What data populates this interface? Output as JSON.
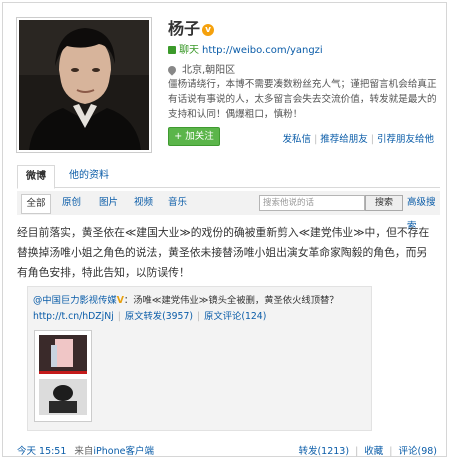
{
  "profile": {
    "name": "杨子",
    "verified_mark": "v",
    "url_label": "聊天",
    "url": "http://weibo.com/yangzi",
    "location": "北京,朝阳区",
    "bio": "僵杨请绕行，本博不需要凑数粉丝充人气；谨把留言机会给真正有话说有事说的人，太多留言会失去交流价值，转发就是最大的支持和认同！偶爆粗口，慎粉！",
    "follow_label": "+ 加关注",
    "actions": [
      "发私信",
      "推荐给朋友",
      "引荐朋友给他"
    ]
  },
  "tabs": [
    "微博",
    "他的资料"
  ],
  "filters": {
    "items": [
      "全部",
      "原创",
      "图片",
      "视频",
      "音乐"
    ],
    "search_placeholder": "搜索他说的话",
    "search_button": "搜索",
    "advanced": "高级搜索"
  },
  "post": {
    "text": "经目前落实，黄圣依在≪建国大业≫的戏份的确被重新剪入≪建党伟业≫中，但不存在替换掉汤唯小姐之角色的说法，黄圣依未接替汤唯小姐出演女革命家陶毅的角色，而另有角色安排，特此告知，以防误传！",
    "repost": {
      "author": "@中国巨力影视传媒",
      "verified_mark": "V",
      "text": "：汤唯≪建党伟业≫镜头全被删，黄圣依火线顶替？",
      "link": "http://t.cn/hDZjNj",
      "repost_count": "原文转发(3957)",
      "comment_count": "原文评论(124)"
    },
    "time": "今天 15:51",
    "from_label": "来自",
    "source": "iPhone客户端",
    "stats": [
      "转发(1213)",
      "收藏",
      "评论(98)"
    ]
  }
}
